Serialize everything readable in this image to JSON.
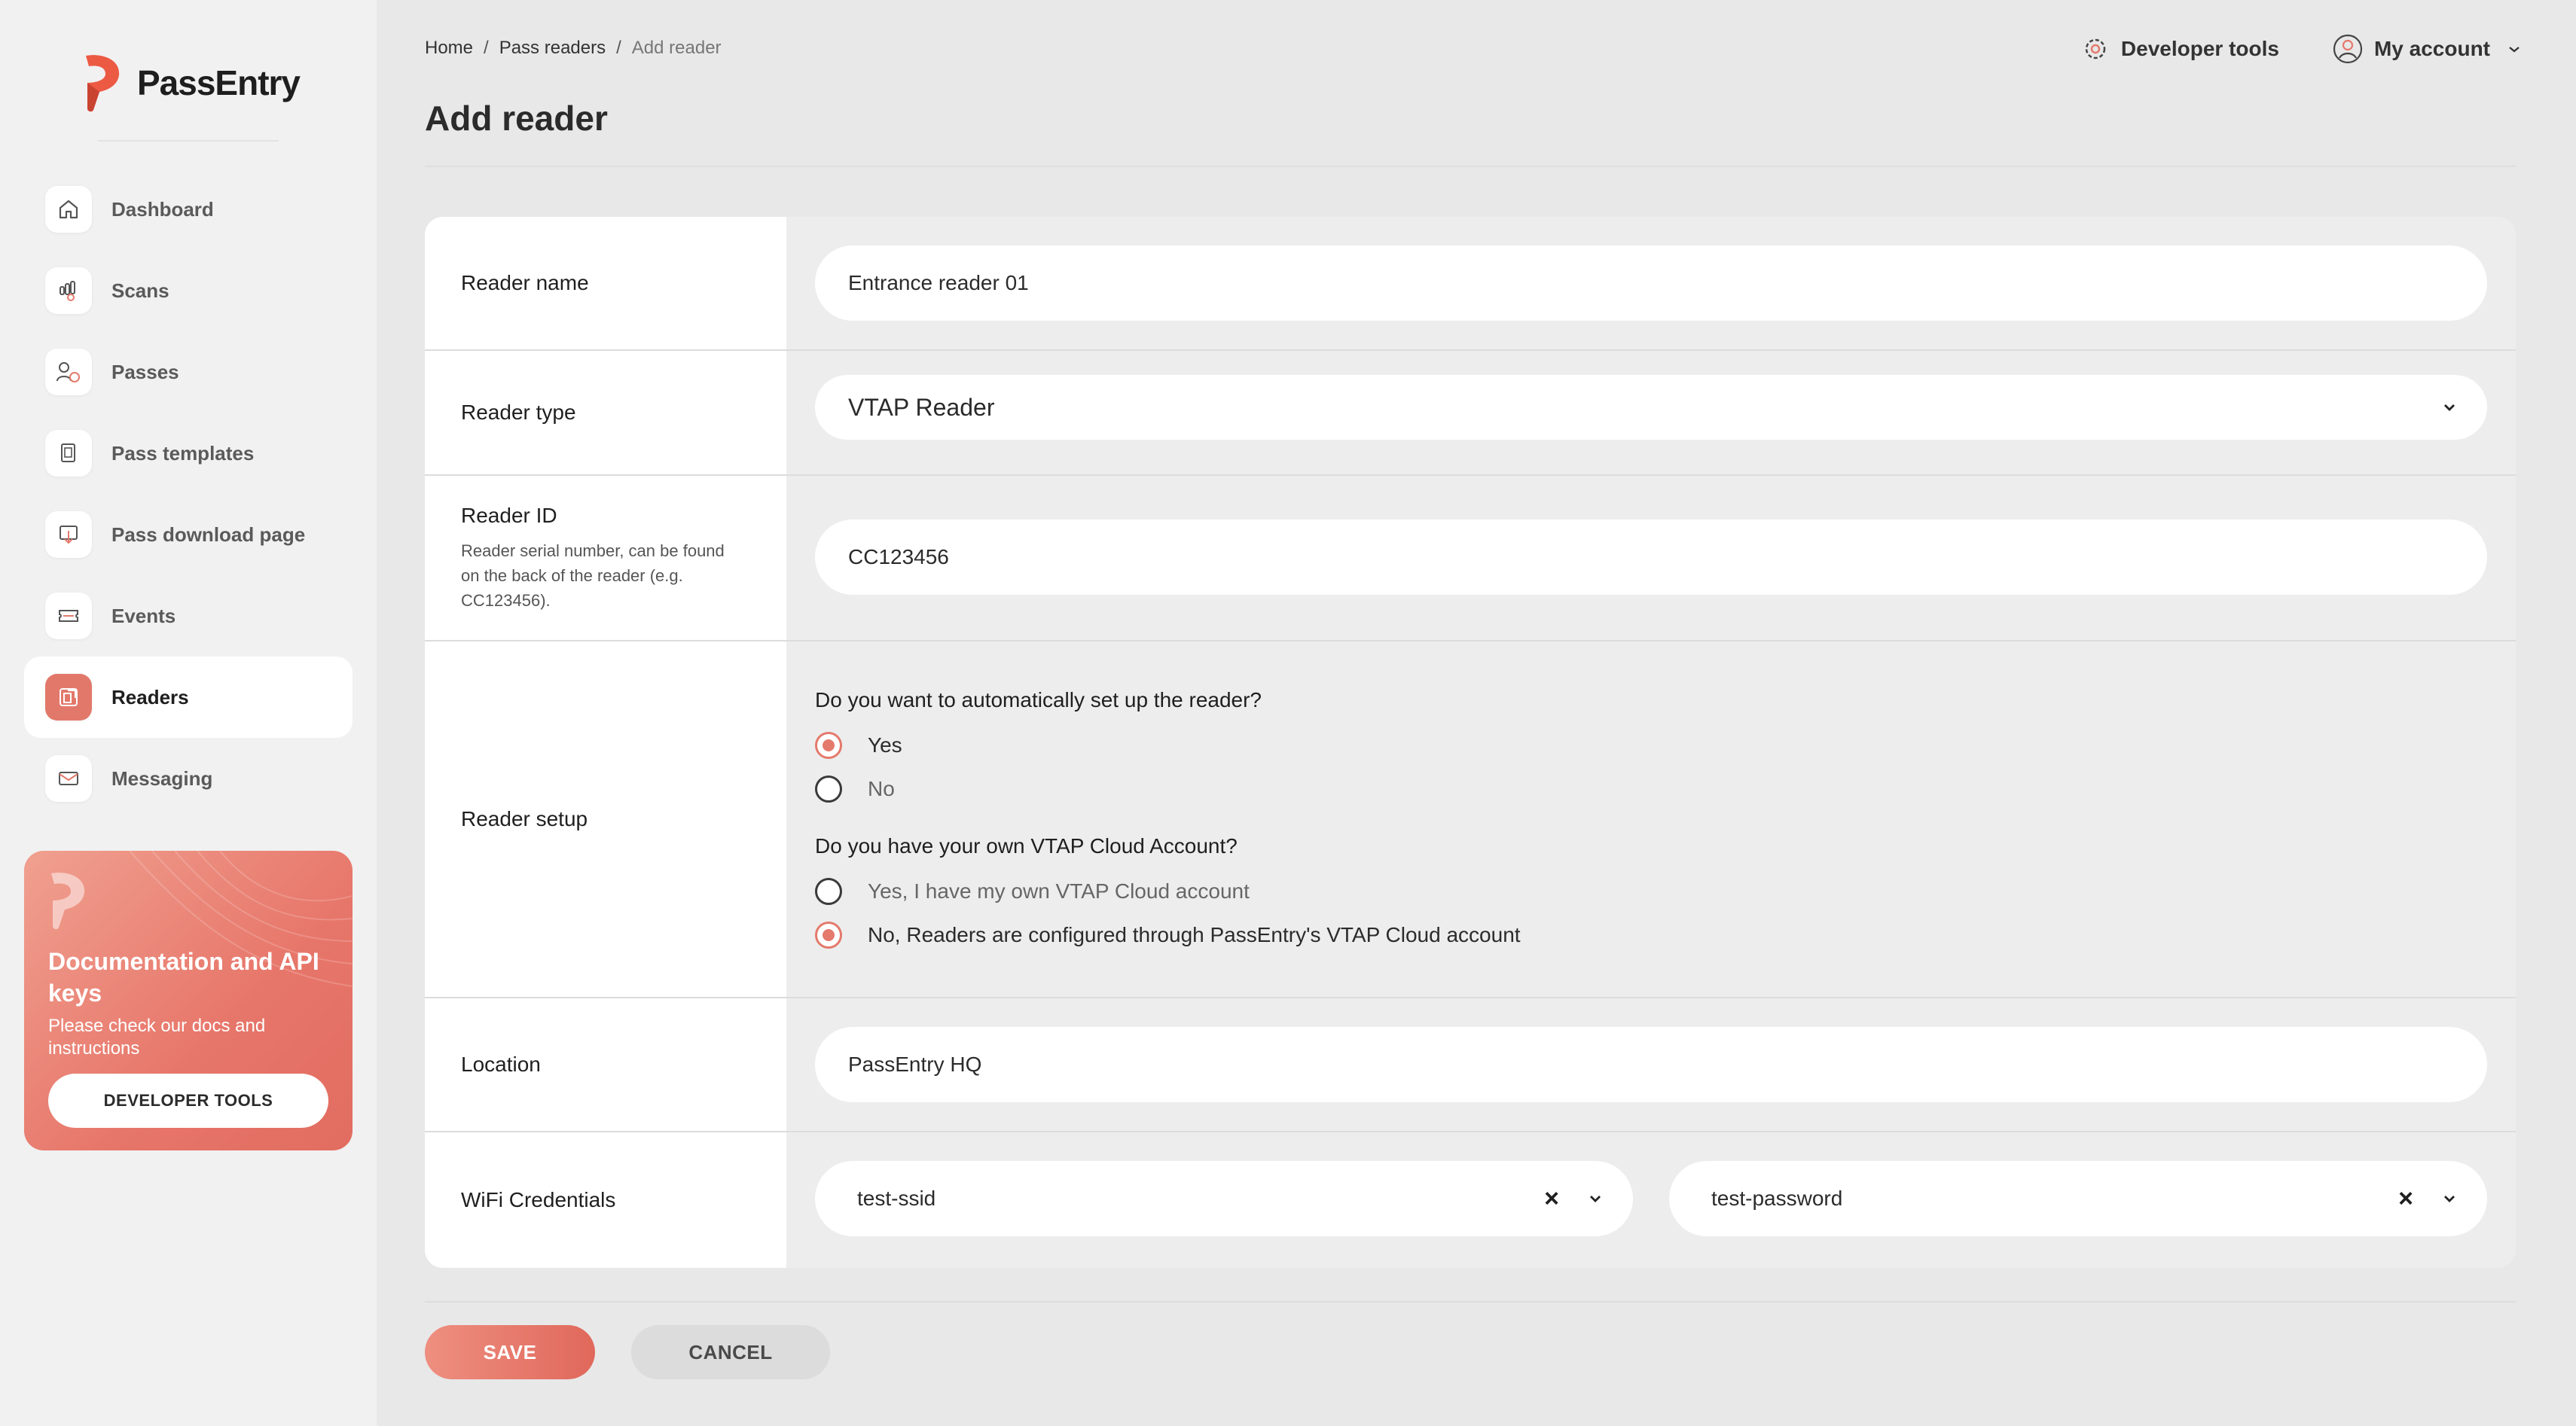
{
  "app": {
    "name": "PassEntry"
  },
  "sidebar": {
    "items": [
      {
        "label": "Dashboard",
        "icon": "home-icon",
        "active": false
      },
      {
        "label": "Scans",
        "icon": "scan-hand-icon",
        "active": false
      },
      {
        "label": "Passes",
        "icon": "passes-icon",
        "active": false
      },
      {
        "label": "Pass templates",
        "icon": "templates-icon",
        "active": false
      },
      {
        "label": "Pass download page",
        "icon": "download-page-icon",
        "active": false
      },
      {
        "label": "Events",
        "icon": "ticket-icon",
        "active": false
      },
      {
        "label": "Readers",
        "icon": "reader-icon",
        "active": true
      },
      {
        "label": "Messaging",
        "icon": "mail-icon",
        "active": false
      }
    ],
    "promo": {
      "title": "Documentation and API keys",
      "text": "Please check our docs and instructions",
      "button": "DEVELOPER TOOLS"
    }
  },
  "header": {
    "breadcrumb": [
      "Home",
      "Pass readers",
      "Add reader"
    ],
    "title": "Add reader",
    "developer_tools": "Developer tools",
    "my_account": "My account"
  },
  "form": {
    "reader_name": {
      "label": "Reader name",
      "value": "Entrance reader 01"
    },
    "reader_type": {
      "label": "Reader type",
      "value": "VTAP Reader"
    },
    "reader_id": {
      "label": "Reader ID",
      "hint": "Reader serial number, can be found on the back of the reader (e.g. CC123456).",
      "value": "CC123456"
    },
    "reader_setup": {
      "label": "Reader setup",
      "question1": "Do you want to automatically set up the reader?",
      "q1_options": [
        {
          "label": "Yes",
          "selected": true
        },
        {
          "label": "No",
          "selected": false
        }
      ],
      "question2": "Do you have your own VTAP Cloud Account?",
      "q2_options": [
        {
          "label": "Yes, I have my own VTAP Cloud account",
          "selected": false
        },
        {
          "label": "No, Readers are configured through PassEntry's VTAP Cloud account",
          "selected": true
        }
      ]
    },
    "location": {
      "label": "Location",
      "value": "PassEntry HQ"
    },
    "wifi": {
      "label": "WiFi Credentials",
      "ssid": "test-ssid",
      "password": "test-password"
    }
  },
  "actions": {
    "save": "SAVE",
    "cancel": "CANCEL"
  },
  "colors": {
    "accent": "#e47a6c",
    "accent_dark": "#e0685b",
    "background": "#e8e8e8"
  }
}
